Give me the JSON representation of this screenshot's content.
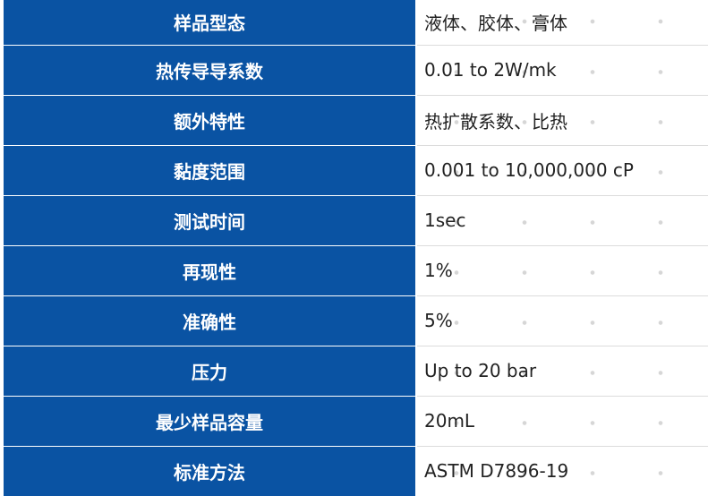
{
  "spec_table": {
    "rows": [
      {
        "label": "样品型态",
        "value": "液体、胶体、膏体"
      },
      {
        "label": "热传导导系数",
        "value": "0.01 to 2W/mk"
      },
      {
        "label": "额外特性",
        "value": "热扩散系数、比热"
      },
      {
        "label": "黏度范围",
        "value": "0.001 to 10,000,000 cP"
      },
      {
        "label": "测试时间",
        "value": "1sec"
      },
      {
        "label": "再现性",
        "value": "1%"
      },
      {
        "label": "准确性",
        "value": "5%"
      },
      {
        "label": "压力",
        "value": "Up to 20 bar"
      },
      {
        "label": "最少样品容量",
        "value": "20mL"
      },
      {
        "label": "标准方法",
        "value": "ASTM D7896-19"
      }
    ]
  },
  "colors": {
    "label_background": "#0a53a3",
    "label_text": "#ffffff",
    "value_text": "#222222"
  }
}
